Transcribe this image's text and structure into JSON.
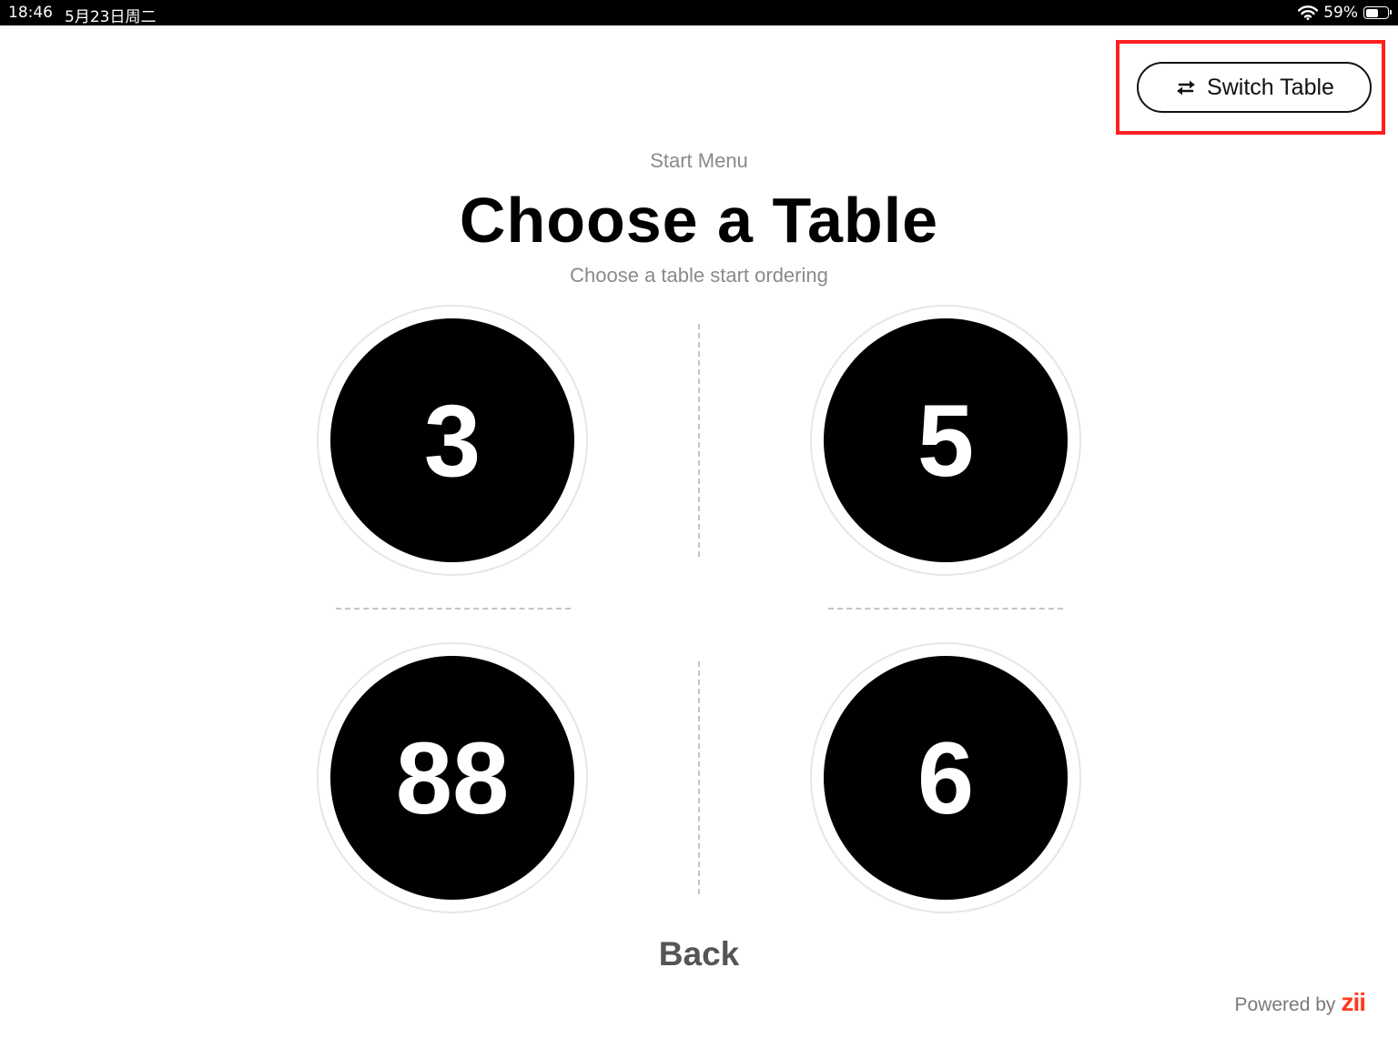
{
  "status_bar": {
    "time": "18:46",
    "date": "5月23日周二",
    "battery_percent_label": "59%",
    "battery_level": 0.59,
    "icons": [
      "wifi-icon",
      "battery-icon"
    ]
  },
  "header": {
    "switch_table_label": "Switch Table",
    "switch_icon": "swap-arrows-icon"
  },
  "main": {
    "eyebrow": "Start Menu",
    "title": "Choose a Table",
    "subtitle": "Choose a table start ordering",
    "tables": [
      {
        "number": "3"
      },
      {
        "number": "5"
      },
      {
        "number": "88"
      },
      {
        "number": "6"
      }
    ]
  },
  "footer": {
    "back_label": "Back",
    "powered_by": "Powered by",
    "brand": "zii"
  },
  "colors": {
    "highlight": "#ff1f1f",
    "brand": "#ff3b1f",
    "circle": "#000000",
    "muted_text": "#8a8a8a"
  }
}
